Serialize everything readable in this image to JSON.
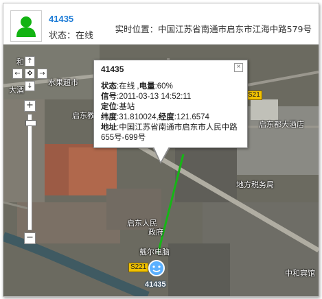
{
  "header": {
    "device_name": "41435",
    "status": "状态：在线",
    "location": "实时位置：中国江苏省南通市启东市江海中路579号"
  },
  "map": {
    "labels": {
      "shuiguo": "水果超市",
      "qidong_jiao": "启东教",
      "qidong_du": "启东都大酒店",
      "dishui": "地方税务局",
      "qidong_renmin": "启东人民",
      "zhengfu": "政府",
      "daier": "戴尔电脑",
      "zhonghe": "中和宾馆",
      "he": "和",
      "dajiu": "大酒"
    },
    "road_badges": [
      "S21",
      "S221"
    ],
    "nav": {
      "up": "↑",
      "down": "↓",
      "left": "←",
      "right": "→",
      "center": "✥"
    },
    "zoom": {
      "in": "+",
      "out": "−"
    },
    "marker_label": "41435"
  },
  "info_window": {
    "title": "41435",
    "close": "×",
    "rows": [
      {
        "label": "状态",
        "value": ":在线 ,",
        "label2": "电量",
        "value2": ":60%"
      },
      {
        "label": "信号",
        "value": ":2011-03-13 14:52:11"
      },
      {
        "label": "定位",
        "value": ":基站"
      },
      {
        "label": "纬度",
        "value": ":31.810024,",
        "label2": "经度",
        "value2": ":121.6574"
      },
      {
        "label": "地址",
        "value": ":中国江苏省南通市启东市人民中路655号-699号"
      }
    ]
  },
  "colors": {
    "accent": "#1c7bd6",
    "route": "#16b616",
    "road_badge": "#f2c200"
  }
}
